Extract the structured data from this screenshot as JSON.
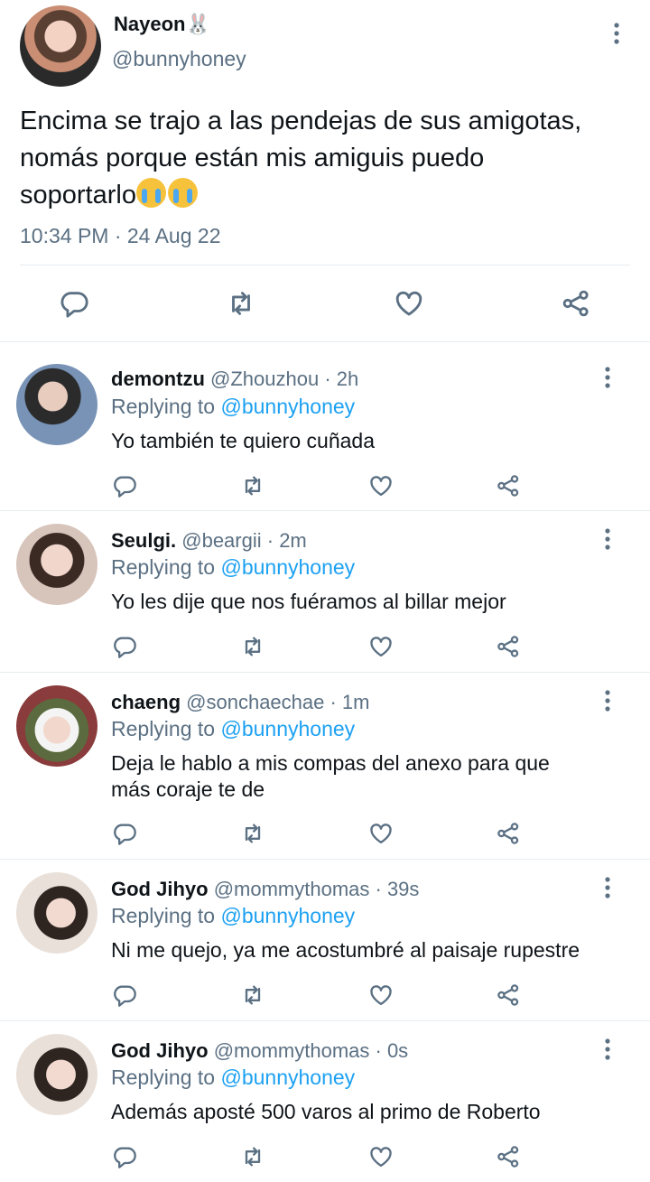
{
  "main_tweet": {
    "name": "Nayeon🐰",
    "handle": "@bunnyhoney",
    "text": "Encima se trajo a las pendejas de sus amigotas,\nnomás porque están mis amiguis puedo\nsoportarlo",
    "emoji": "😭😭",
    "timestamp": "10:34 PM · 24 Aug 22",
    "actions": [
      "reply-icon",
      "retweet-icon",
      "like-icon",
      "share-icon"
    ]
  },
  "replies": [
    {
      "name": "demontzu",
      "handle": "@Zhouzhou",
      "time": " · 2h",
      "replying_prefix": "Replying to ",
      "replying_to": "@bunnyhoney",
      "text": "Yo también te quiero cuñada"
    },
    {
      "name": "Seulgi.",
      "handle": "@beargii",
      "time": " · 2m",
      "replying_prefix": "Replying to ",
      "replying_to": "@bunnyhoney",
      "text": "Yo les dije que nos fuéramos al billar mejor"
    },
    {
      "name": "chaeng",
      "handle": "@sonchaechae",
      "time": " · 1m",
      "replying_prefix": "Replying to ",
      "replying_to": "@bunnyhoney",
      "text": "Deja le hablo a mis compas del anexo para que más coraje te de"
    },
    {
      "name": "God Jihyo",
      "handle": "@mommythomas",
      "time": " · 39s",
      "replying_prefix": "Replying to ",
      "replying_to": "@bunnyhoney",
      "text": "Ni me quejo, ya me acostumbré al paisaje rupestre"
    },
    {
      "name": "God Jihyo",
      "handle": "@mommythomas",
      "time": " · 0s",
      "replying_prefix": "Replying to ",
      "replying_to": "@bunnyhoney",
      "text": "Además aposté 500 varos al primo de Roberto"
    }
  ],
  "colors": {
    "link": "#1da1f2",
    "secondary_text": "#5b7083",
    "divider": "#e6ecf0"
  }
}
